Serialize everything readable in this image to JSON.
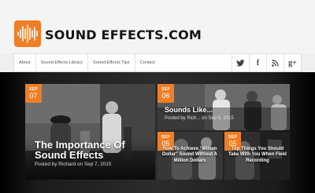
{
  "brand": {
    "name": "SOUND EFFECTS.COM"
  },
  "nav": {
    "items": [
      "About",
      "Sound Effects Library",
      "Sound Effects Tips",
      "Contact"
    ],
    "social": {
      "twitter_icon": "twitter-icon",
      "facebook_icon": "facebook-icon",
      "facebook_glyph": "f",
      "rss_icon": "rss-icon",
      "googleplus_icon": "google-plus-icon",
      "googleplus_glyph": "g+"
    }
  },
  "posts": {
    "feature": {
      "month": "SEP",
      "day": "07",
      "title": "The Importance Of Sound Effects",
      "byline": "Posted by Richard on Sep 7, 2015"
    },
    "top_right": {
      "month": "SEP",
      "day": "06",
      "title": "Sounds Like...",
      "byline": "Posted by Rich... on Sep 6, 2015"
    },
    "bottom_mid": {
      "month": "SEP",
      "day": "05",
      "title": "How To Achieve \"Million Dollar\" Sound Without A Million Dollars"
    },
    "bottom_right": {
      "month": "SEP",
      "day": "05",
      "title": "Top Things You Should Take With You When Field Recording"
    }
  },
  "colors": {
    "accent": "#f07e24",
    "band": "#2c2c2c",
    "header_bg": "#f4f4f4"
  }
}
